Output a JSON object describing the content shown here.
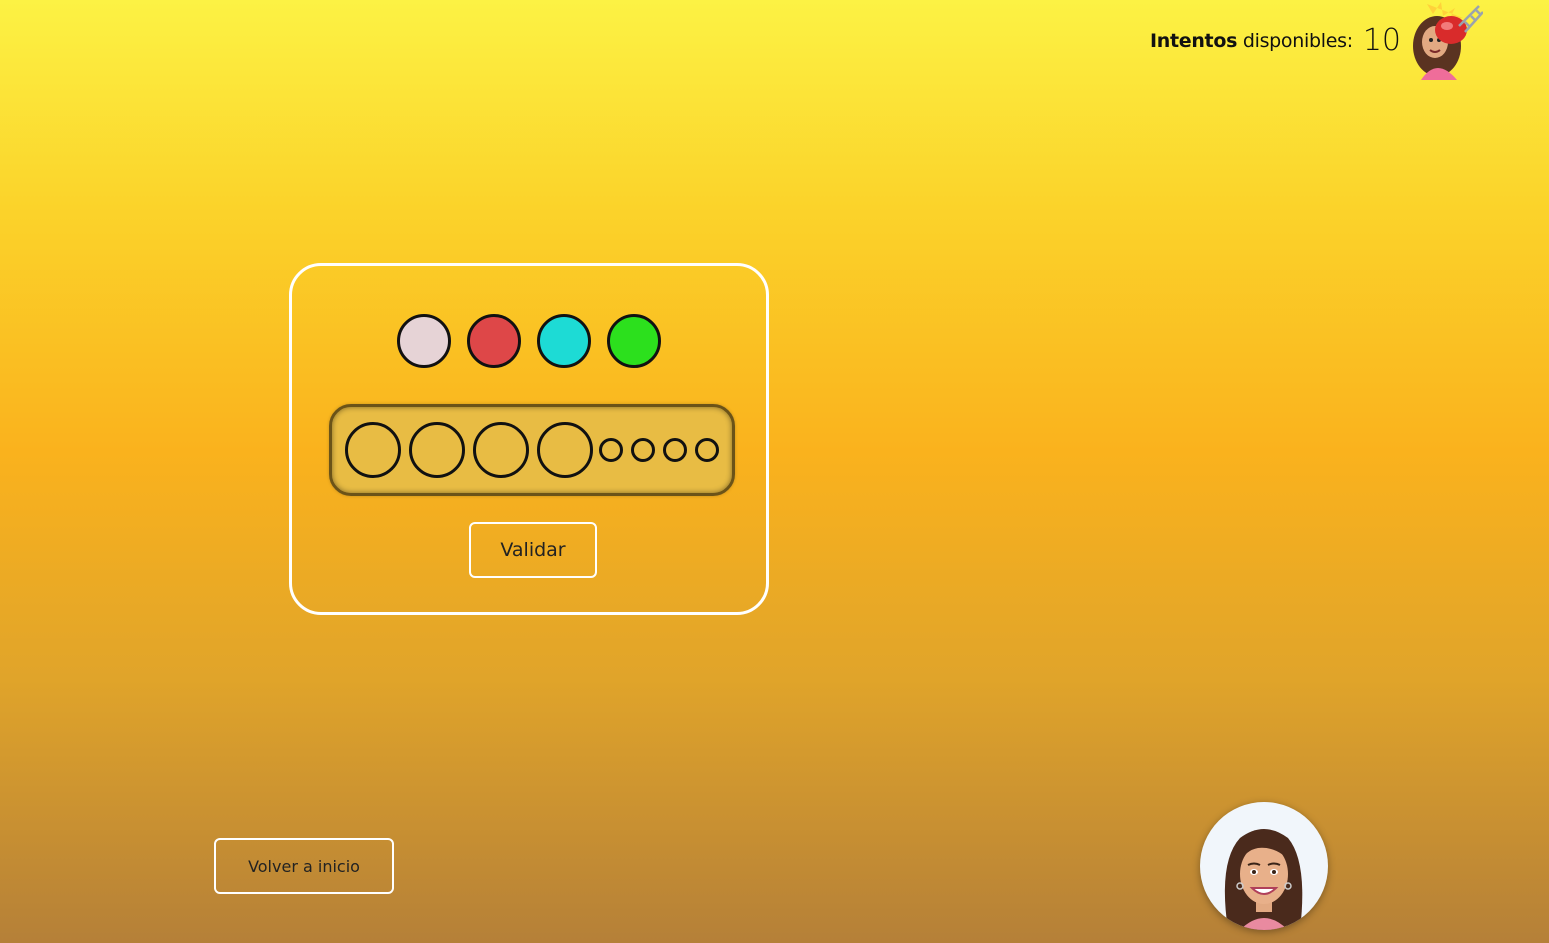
{
  "header": {
    "attempts_label_bold": "Intentos",
    "attempts_label_rest": " disponibles:",
    "attempts_count": "10",
    "avatar_icon": "boxing-avatar-icon"
  },
  "palette": {
    "colors": [
      "#e6d3d6",
      "#de4748",
      "#1ddbd5",
      "#2ce01d"
    ]
  },
  "board": {
    "slots": 4,
    "hints": 4
  },
  "actions": {
    "validate_label": "Validar",
    "back_label": "Volver a inicio"
  },
  "assistant": {
    "avatar_icon": "assistant-avatar-icon"
  }
}
